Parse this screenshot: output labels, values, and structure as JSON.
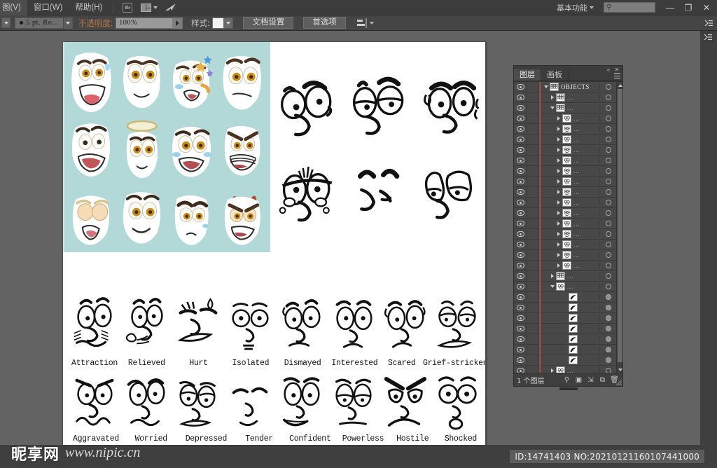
{
  "app": {
    "title": "Adobe Illustrator",
    "menubar": {
      "items": [
        {
          "label": "图(V)",
          "name": "menu-view"
        },
        {
          "label": "窗口(W)",
          "name": "menu-window"
        },
        {
          "label": "帮助(H)",
          "name": "menu-help"
        }
      ],
      "icons": [
        {
          "name": "bridge-icon",
          "glyph": "Br"
        },
        {
          "name": "arrange-documents-icon",
          "glyph": ""
        },
        {
          "name": "adobe-logo-icon",
          "glyph": ""
        }
      ],
      "workspace_label": "基本功能",
      "search_placeholder": "",
      "window_buttons": {
        "minimize": "—",
        "restore": "❐",
        "close": "✕"
      }
    },
    "controlbar": {
      "stroke_label": "5 pt. Ro...",
      "opacity_label": "不透明度:",
      "opacity_value": "100%",
      "style_label": "样式:",
      "document_setup_button": "文档设置",
      "preferences_button": "首选项",
      "align_label": "对齐"
    }
  },
  "layers_panel": {
    "tabs": [
      {
        "label": "图层",
        "active": true,
        "name": "tab-layers"
      },
      {
        "label": "画板",
        "active": false,
        "name": "tab-artboards"
      }
    ],
    "footer_text": "1 个图层",
    "footer_icons": [
      "locate-object-icon",
      "make-clipping-mask-icon",
      "create-new-sublayer-icon",
      "create-new-layer-icon",
      "delete-selection-icon"
    ],
    "rows": [
      {
        "name": "OBJECTS",
        "indent": 0,
        "twisty": "down",
        "thumb": "group",
        "target": "ring"
      },
      {
        "name": "...",
        "indent": 1,
        "twisty": "right",
        "thumb": "group",
        "target": "ring"
      },
      {
        "name": "...",
        "indent": 1,
        "twisty": "down",
        "thumb": "group",
        "target": "ring"
      },
      {
        "name": "...",
        "indent": 2,
        "twisty": "right",
        "thumb": "face",
        "target": "ring"
      },
      {
        "name": "...",
        "indent": 2,
        "twisty": "right",
        "thumb": "face",
        "target": "ring"
      },
      {
        "name": "...",
        "indent": 2,
        "twisty": "right",
        "thumb": "face",
        "target": "ring"
      },
      {
        "name": "...",
        "indent": 2,
        "twisty": "right",
        "thumb": "face",
        "target": "ring"
      },
      {
        "name": "...",
        "indent": 2,
        "twisty": "right",
        "thumb": "face",
        "target": "ring"
      },
      {
        "name": "...",
        "indent": 2,
        "twisty": "right",
        "thumb": "face",
        "target": "ring"
      },
      {
        "name": "...",
        "indent": 2,
        "twisty": "right",
        "thumb": "face",
        "target": "ring"
      },
      {
        "name": "...",
        "indent": 2,
        "twisty": "right",
        "thumb": "face",
        "target": "ring"
      },
      {
        "name": "...",
        "indent": 2,
        "twisty": "right",
        "thumb": "face",
        "target": "ring"
      },
      {
        "name": "...",
        "indent": 2,
        "twisty": "right",
        "thumb": "face",
        "target": "ring"
      },
      {
        "name": "...",
        "indent": 2,
        "twisty": "right",
        "thumb": "face",
        "target": "ring"
      },
      {
        "name": "...",
        "indent": 2,
        "twisty": "right",
        "thumb": "face",
        "target": "ring"
      },
      {
        "name": "...",
        "indent": 2,
        "twisty": "right",
        "thumb": "face",
        "target": "ring"
      },
      {
        "name": "...",
        "indent": 2,
        "twisty": "right",
        "thumb": "face",
        "target": "ring"
      },
      {
        "name": "...",
        "indent": 2,
        "twisty": "right",
        "thumb": "face",
        "target": "ring"
      },
      {
        "name": "...",
        "indent": 1,
        "twisty": "right",
        "thumb": "group",
        "target": "ring"
      },
      {
        "name": "...",
        "indent": 1,
        "twisty": "down",
        "thumb": "face",
        "target": "ring"
      },
      {
        "name": "",
        "indent": 3,
        "twisty": "none",
        "thumb": "path",
        "target": "filled"
      },
      {
        "name": "",
        "indent": 3,
        "twisty": "none",
        "thumb": "path",
        "target": "filled"
      },
      {
        "name": "",
        "indent": 3,
        "twisty": "none",
        "thumb": "path",
        "target": "filled"
      },
      {
        "name": "",
        "indent": 3,
        "twisty": "none",
        "thumb": "path",
        "target": "filled"
      },
      {
        "name": "",
        "indent": 3,
        "twisty": "none",
        "thumb": "path",
        "target": "filled"
      },
      {
        "name": "",
        "indent": 3,
        "twisty": "none",
        "thumb": "path",
        "target": "filled"
      },
      {
        "name": "",
        "indent": 3,
        "twisty": "none",
        "thumb": "path",
        "target": "filled"
      },
      {
        "name": "...",
        "indent": 1,
        "twisty": "right",
        "thumb": "face",
        "target": "ring"
      },
      {
        "name": "...",
        "indent": 1,
        "twisty": "right",
        "thumb": "face",
        "target": "ring"
      },
      {
        "name": "...",
        "indent": 1,
        "twisty": "right",
        "thumb": "face",
        "target": "ring"
      }
    ]
  },
  "canvas": {
    "tint_color": "#b3d8d8",
    "face_rows": [
      {
        "labels": [
          "Attraction",
          "Relieved",
          "Hurt",
          "Isolated",
          "Dismayed",
          "Interested",
          "Scared",
          "Grief-stricken"
        ]
      },
      {
        "labels": [
          "Aggravated",
          "Worried",
          "Depressed",
          "Tender",
          "Confident",
          "Powerless",
          "Hostile",
          "Shocked"
        ]
      }
    ]
  },
  "watermark": {
    "cn": "昵享网",
    "en": "www.nipic.cn"
  },
  "status": {
    "id_text": "ID:14741403 NO:20210121160107441000"
  },
  "colors": {
    "chrome": "#3f3f3f",
    "menubar": "#3c3c3c",
    "controlbar": "#454545",
    "workarea": "#636363",
    "accent_orange": "#b07a4e",
    "layer_red": "#8e4b4b",
    "tint": "#b3d8d8"
  }
}
